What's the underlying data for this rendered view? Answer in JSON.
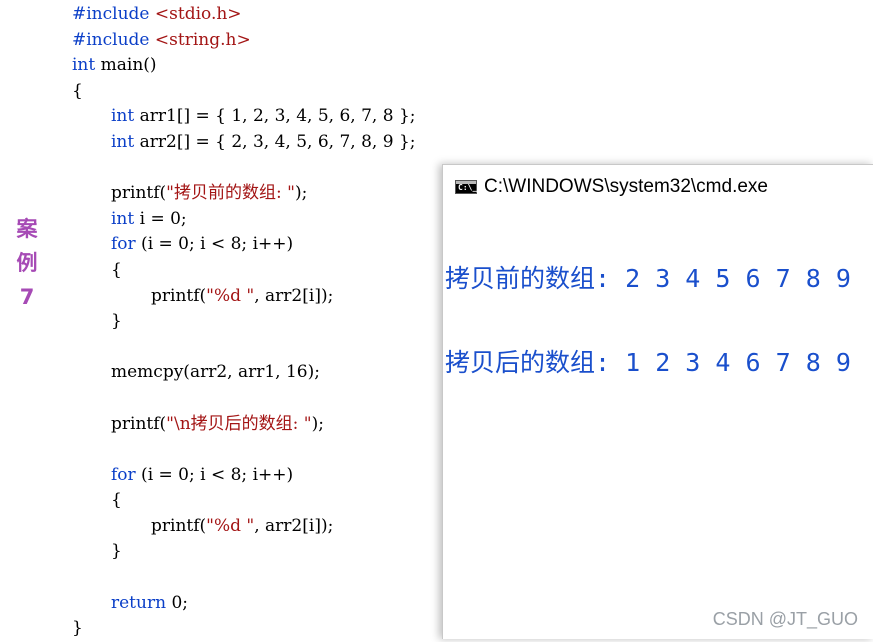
{
  "side_label": [
    "案",
    "例",
    "7"
  ],
  "code": {
    "l1": {
      "pp": "#include",
      "inc": "<stdio.h>"
    },
    "l2": {
      "pp": "#include",
      "inc": "<string.h>"
    },
    "l3": {
      "kw": "int",
      "rest": " main()"
    },
    "l4": "{",
    "l5": {
      "kw": "int",
      "rest": " arr1[] = { 1, 2, 3, 4, 5, 6, 7, 8 };"
    },
    "l6": {
      "kw": "int",
      "rest": " arr2[] = { 2, 3, 4, 5, 6, 7, 8, 9 };"
    },
    "l8": {
      "pre": "printf(",
      "str": "\"拷贝前的数组: \"",
      "post": ");"
    },
    "l9": {
      "kw": "int",
      "rest": " i = 0;"
    },
    "l10": {
      "kw": "for",
      "rest": " (i = 0; i < 8; i++)"
    },
    "l11": "{",
    "l12": {
      "pre": "printf(",
      "str": "\"%d \"",
      "post": ", arr2[i]);"
    },
    "l13": "}",
    "l15": "memcpy(arr2, arr1, 16);",
    "l17": {
      "pre": "printf(",
      "str": "\"\\n拷贝后的数组: \"",
      "post": ");"
    },
    "l19": {
      "kw": "for",
      "rest": " (i = 0; i < 8; i++)"
    },
    "l20": "{",
    "l21": {
      "pre": "printf(",
      "str": "\"%d \"",
      "post": ", arr2[i]);"
    },
    "l22": "}",
    "l24": {
      "kw": "return",
      "rest": " 0;"
    },
    "l25": "}"
  },
  "console": {
    "title": "C:\\WINDOWS\\system32\\cmd.exe",
    "icon": "cmd-window-icon",
    "line1": "拷贝前的数组: 2 3 4 5 6 7 8 9",
    "line2": "拷贝后的数组: 1 2 3 4 6 7 8 9"
  },
  "watermark": "CSDN @JT_GUO"
}
